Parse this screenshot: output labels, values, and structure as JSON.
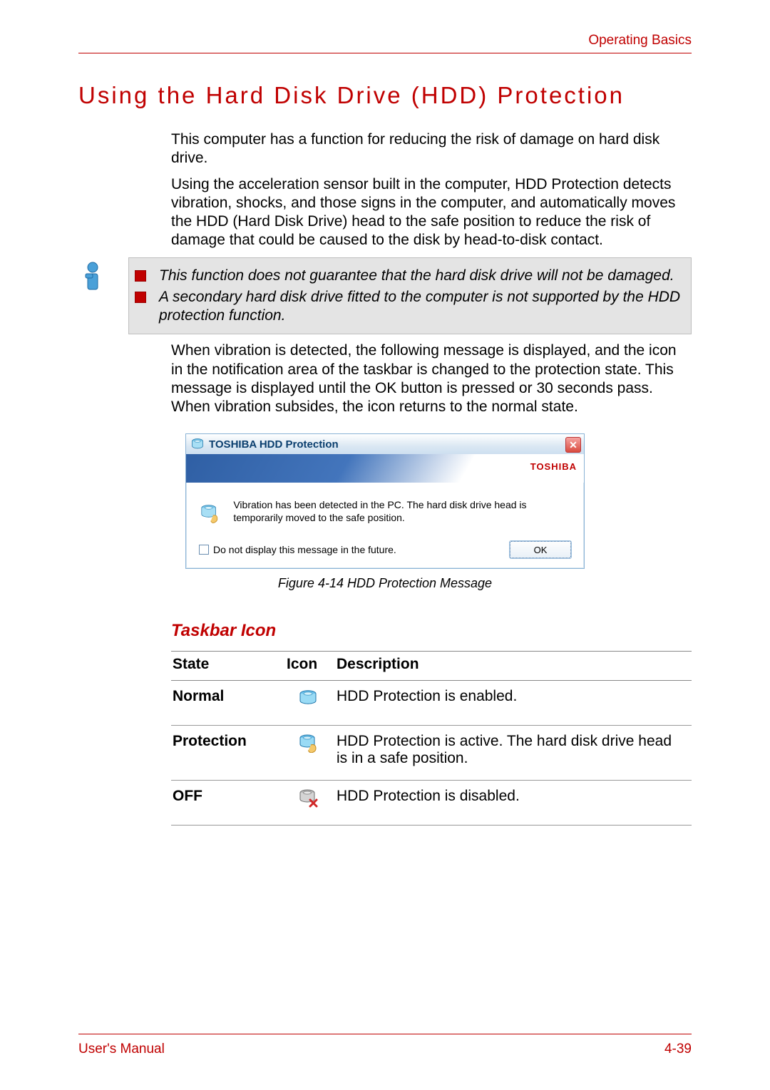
{
  "header": {
    "chapter": "Operating Basics"
  },
  "section": {
    "title": "Using the Hard Disk Drive (HDD) Protection"
  },
  "paragraphs": {
    "p1": "This computer has a function for reducing the risk of damage on hard disk drive.",
    "p2": "Using the acceleration sensor built in the computer, HDD Protection detects vibration, shocks, and those signs in the computer, and automatically moves the HDD (Hard Disk Drive) head to the safe position to reduce the risk of damage that could be caused to the disk by head-to-disk contact.",
    "p3": "When vibration is detected, the following message is displayed, and the icon in the notification area of the taskbar is changed to the protection state. This message is displayed until the OK button is pressed or 30 seconds pass. When vibration subsides, the icon returns to the normal state."
  },
  "notes": {
    "n1": "This function does not guarantee that the hard disk drive will not be damaged.",
    "n2": "A secondary hard disk drive fitted to the computer is not supported by the HDD protection function."
  },
  "dialog": {
    "title": "TOSHIBA HDD Protection",
    "brand": "TOSHIBA",
    "message": "Vibration has been detected in the PC. The hard disk drive head is temporarily moved to the safe position.",
    "checkbox_label": "Do not display this message in the future.",
    "ok_label": "OK"
  },
  "figure_caption": "Figure 4-14 HDD Protection Message",
  "subhead": "Taskbar Icon",
  "table": {
    "headers": {
      "state": "State",
      "icon": "Icon",
      "desc": "Description"
    },
    "rows": [
      {
        "state": "Normal",
        "desc": "HDD Protection is enabled.",
        "icon": "normal"
      },
      {
        "state": "Protection",
        "desc": "HDD Protection is active. The hard disk drive head is in a safe position.",
        "icon": "protection"
      },
      {
        "state": "OFF",
        "desc": "HDD Protection is disabled.",
        "icon": "off"
      }
    ]
  },
  "footer": {
    "left": "User's Manual",
    "right": "4-39"
  }
}
